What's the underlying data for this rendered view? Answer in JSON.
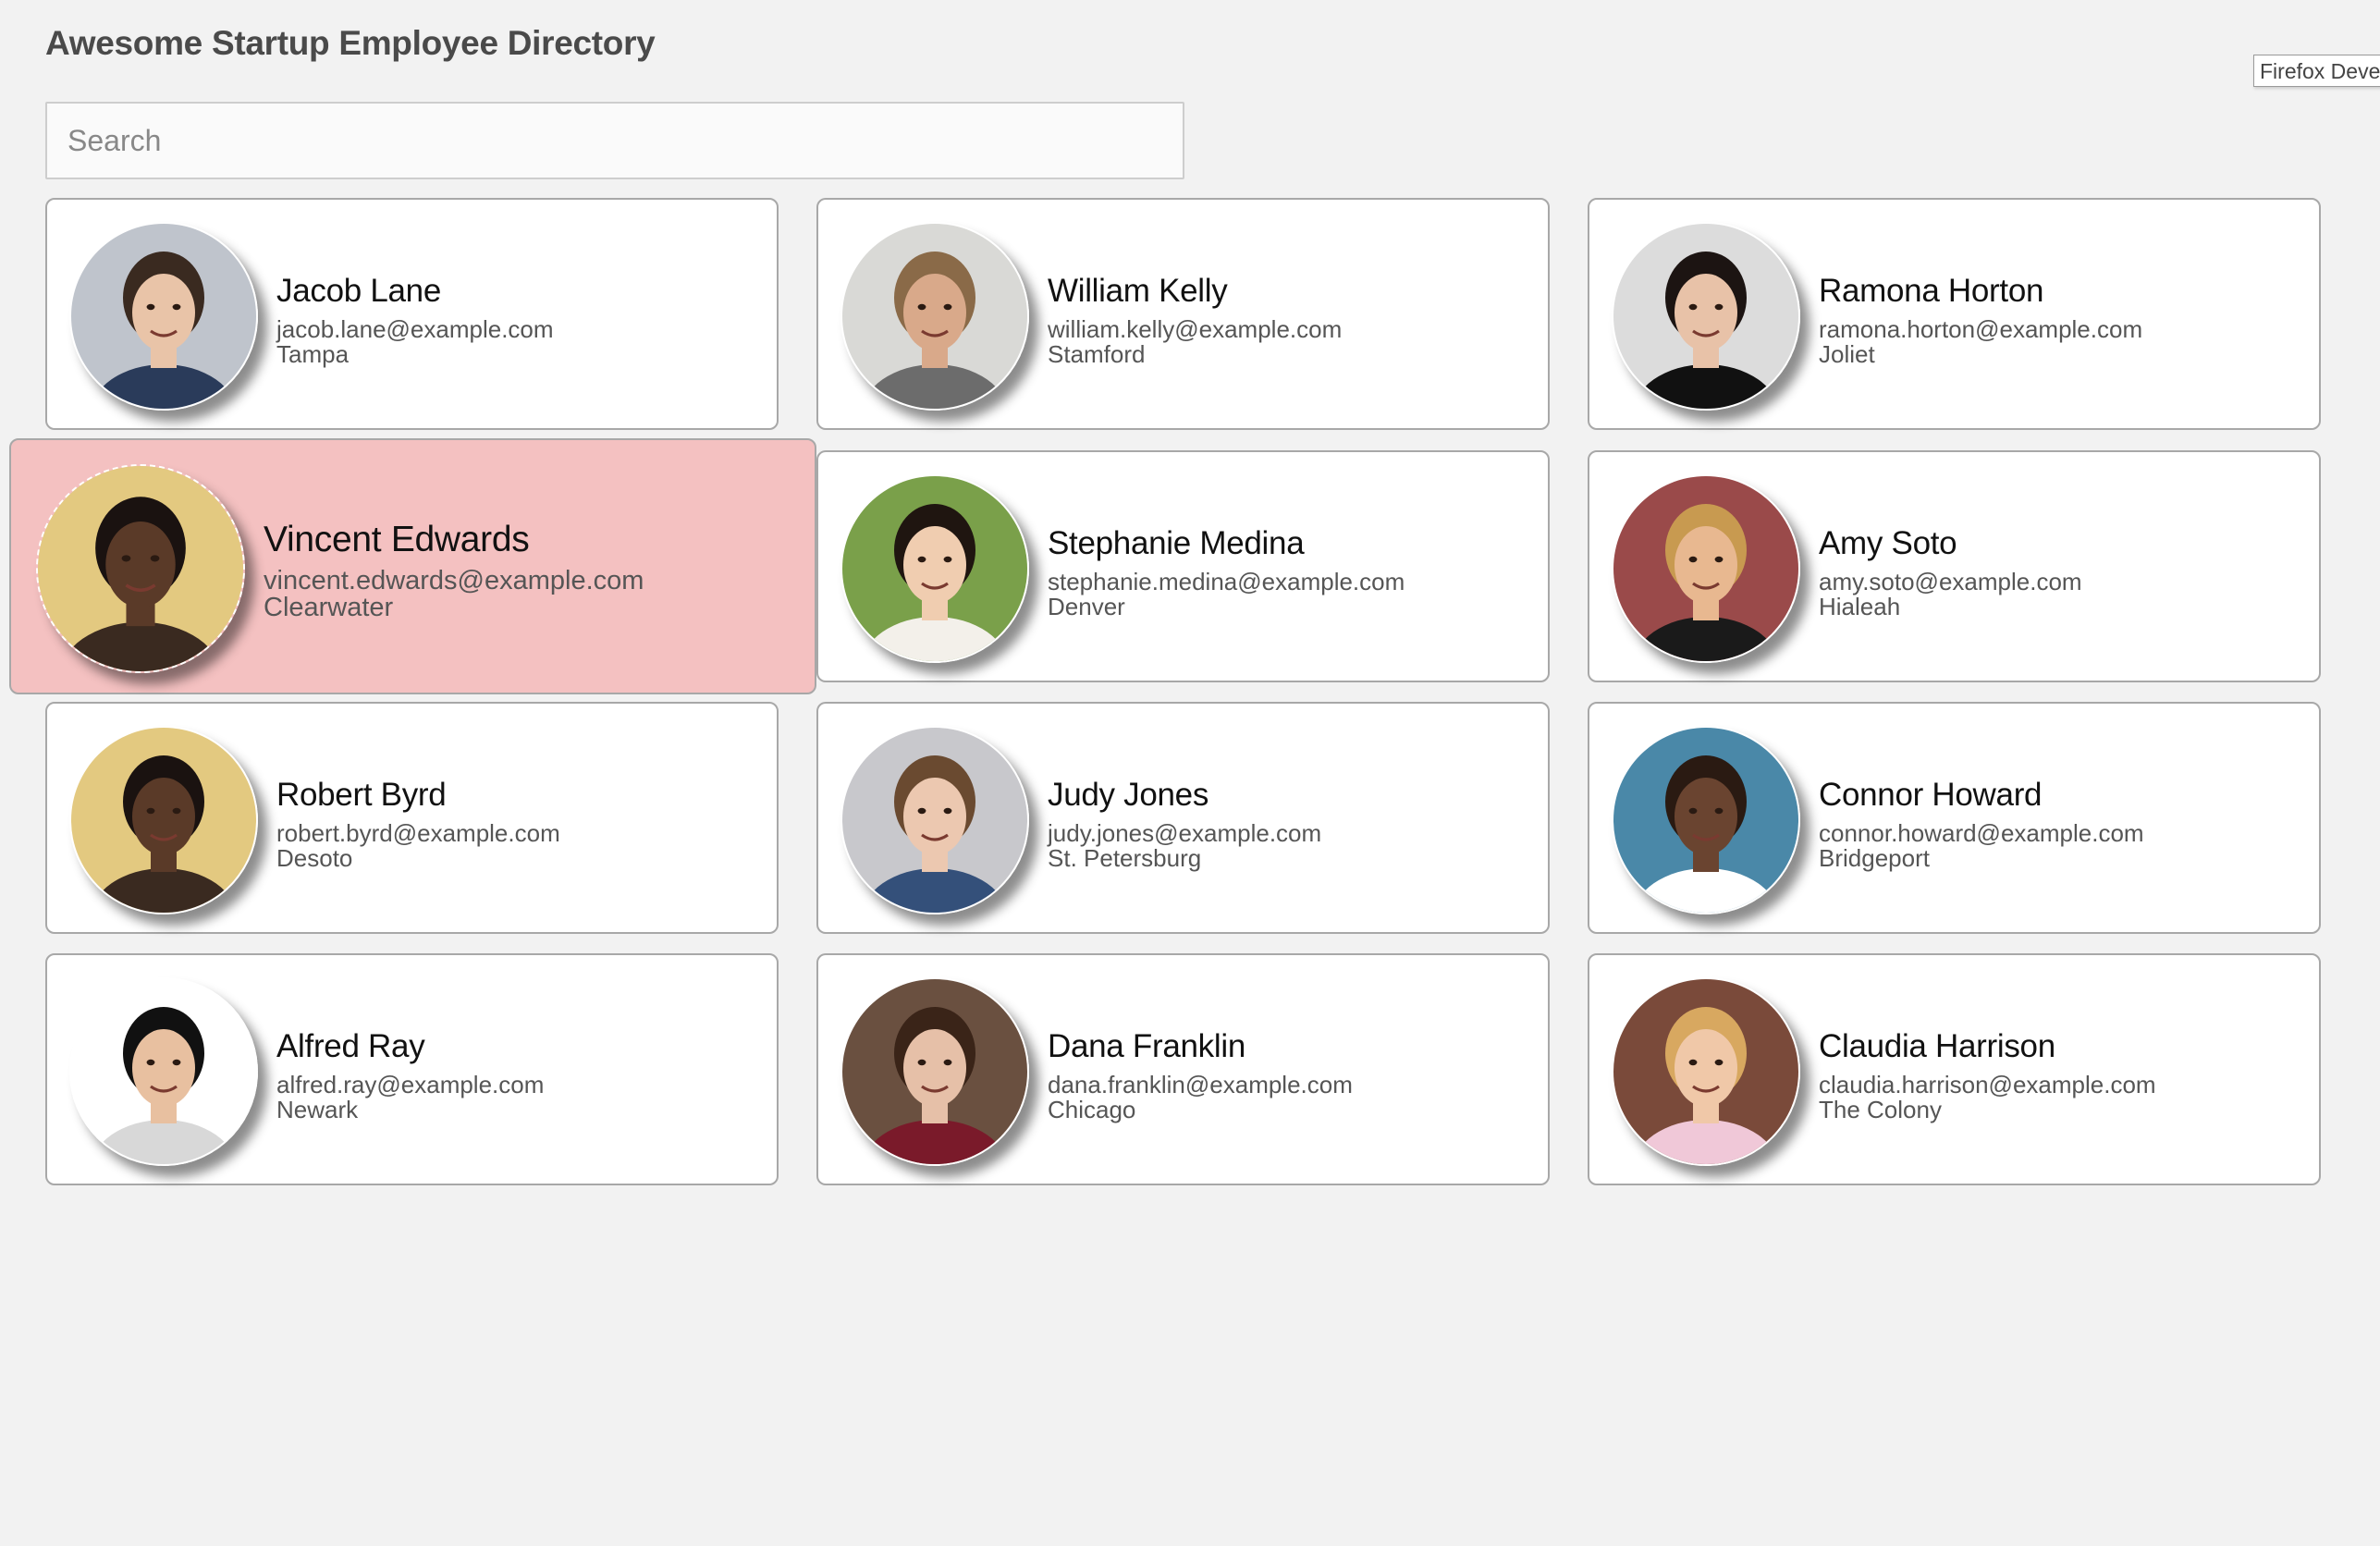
{
  "header": {
    "title": "Awesome Startup Employee Directory",
    "browser_badge": "Firefox Deve"
  },
  "search": {
    "placeholder": "Search",
    "value": ""
  },
  "highlight_color": "#f4c1c1",
  "employees": [
    {
      "name": "Jacob Lane",
      "email": "jacob.lane@example.com",
      "city": "Tampa",
      "photo_icon": "avatar-photo-icon",
      "bg": "#bfc4cc",
      "skin": "#e9c4a8",
      "hair": "#3a2a20",
      "shirt": "#2a3b5a"
    },
    {
      "name": "William Kelly",
      "email": "william.kelly@example.com",
      "city": "Stamford",
      "photo_icon": "avatar-photo-icon",
      "bg": "#d9d9d6",
      "skin": "#d9a98a",
      "hair": "#8a6a48",
      "shirt": "#6c6c6c"
    },
    {
      "name": "Ramona Horton",
      "email": "ramona.horton@example.com",
      "city": "Joliet",
      "photo_icon": "avatar-photo-icon",
      "bg": "#dcdcdc",
      "skin": "#e8c2a8",
      "hair": "#1c1412",
      "shirt": "#111111"
    },
    {
      "name": "Vincent Edwards",
      "email": "vincent.edwards@example.com",
      "city": "Clearwater",
      "photo_icon": "avatar-photo-icon",
      "bg": "#e3c980",
      "skin": "#5a3a28",
      "hair": "#1a1210",
      "shirt": "#3a2a20"
    },
    {
      "name": "Stephanie Medina",
      "email": "stephanie.medina@example.com",
      "city": "Denver",
      "photo_icon": "avatar-photo-icon",
      "bg": "#7aa04a",
      "skin": "#f0cdb0",
      "hair": "#1f1510",
      "shirt": "#f3f0ea"
    },
    {
      "name": "Amy Soto",
      "email": "amy.soto@example.com",
      "city": "Hialeah",
      "photo_icon": "avatar-photo-icon",
      "bg": "#9a4a4a",
      "skin": "#e8b890",
      "hair": "#c89a50",
      "shirt": "#1a1a1a"
    },
    {
      "name": "Robert Byrd",
      "email": "robert.byrd@example.com",
      "city": "Desoto",
      "photo_icon": "avatar-photo-icon",
      "bg": "#e3c980",
      "skin": "#5a3a28",
      "hair": "#1a1210",
      "shirt": "#3a2a20"
    },
    {
      "name": "Judy Jones",
      "email": "judy.jones@example.com",
      "city": "St. Petersburg",
      "photo_icon": "avatar-photo-icon",
      "bg": "#c8c8cc",
      "skin": "#ecc8b0",
      "hair": "#6a4a30",
      "shirt": "#34507a"
    },
    {
      "name": "Connor Howard",
      "email": "connor.howard@example.com",
      "city": "Bridgeport",
      "photo_icon": "avatar-photo-icon",
      "bg": "#4a88a8",
      "skin": "#6a4430",
      "hair": "#2a1a12",
      "shirt": "#ffffff"
    },
    {
      "name": "Alfred Ray",
      "email": "alfred.ray@example.com",
      "city": "Newark",
      "photo_icon": "avatar-photo-icon",
      "bg": "#ffffff",
      "skin": "#e8c0a0",
      "hair": "#111111",
      "shirt": "#d8d8d8"
    },
    {
      "name": "Dana Franklin",
      "email": "dana.franklin@example.com",
      "city": "Chicago",
      "photo_icon": "avatar-photo-icon",
      "bg": "#6a5040",
      "skin": "#e6c0a8",
      "hair": "#3a2418",
      "shirt": "#7a1a2a"
    },
    {
      "name": "Claudia Harrison",
      "email": "claudia.harrison@example.com",
      "city": "The Colony",
      "photo_icon": "avatar-photo-icon",
      "bg": "#7a4a3a",
      "skin": "#f0c8a8",
      "hair": "#d8a860",
      "shirt": "#f0c8d8"
    }
  ]
}
